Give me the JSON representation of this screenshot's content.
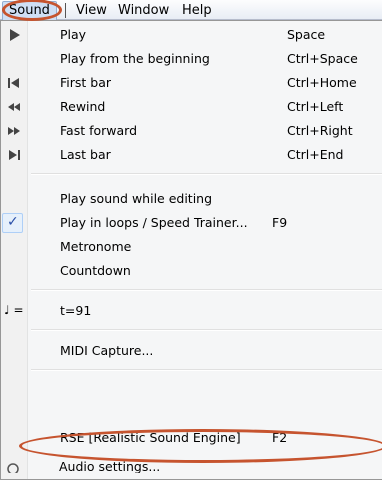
{
  "menubar": {
    "sound": "Sound",
    "view": "View",
    "window": "Window",
    "help": "Help"
  },
  "menu": {
    "play": {
      "label": "Play",
      "shortcut": "Space"
    },
    "play_beginning": {
      "label": "Play from the beginning",
      "shortcut": "Ctrl+Space"
    },
    "first_bar": {
      "label": "First bar",
      "shortcut": "Ctrl+Home"
    },
    "rewind": {
      "label": "Rewind",
      "shortcut": "Ctrl+Left"
    },
    "fast_forward": {
      "label": "Fast forward",
      "shortcut": "Ctrl+Right"
    },
    "last_bar": {
      "label": "Last bar",
      "shortcut": "Ctrl+End"
    },
    "play_sound_editing": {
      "label": "Play sound while editing"
    },
    "play_loops": {
      "label": "Play in loops / Speed Trainer...",
      "shortcut": "F9",
      "checked": true
    },
    "metronome": {
      "label": "Metronome"
    },
    "countdown": {
      "label": "Countdown"
    },
    "tempo": {
      "label": "t=91",
      "icon_text": "♩ ="
    },
    "midi_capture": {
      "label": "MIDI Capture..."
    },
    "rse": {
      "label": "RSE [Realistic Sound Engine]",
      "shortcut": "F2"
    },
    "audio": {
      "label": "Audio settings..."
    }
  },
  "colors": {
    "callout": "#c6542f",
    "check": "#2a4fa8",
    "menu_bg": "#f5f6f7"
  }
}
